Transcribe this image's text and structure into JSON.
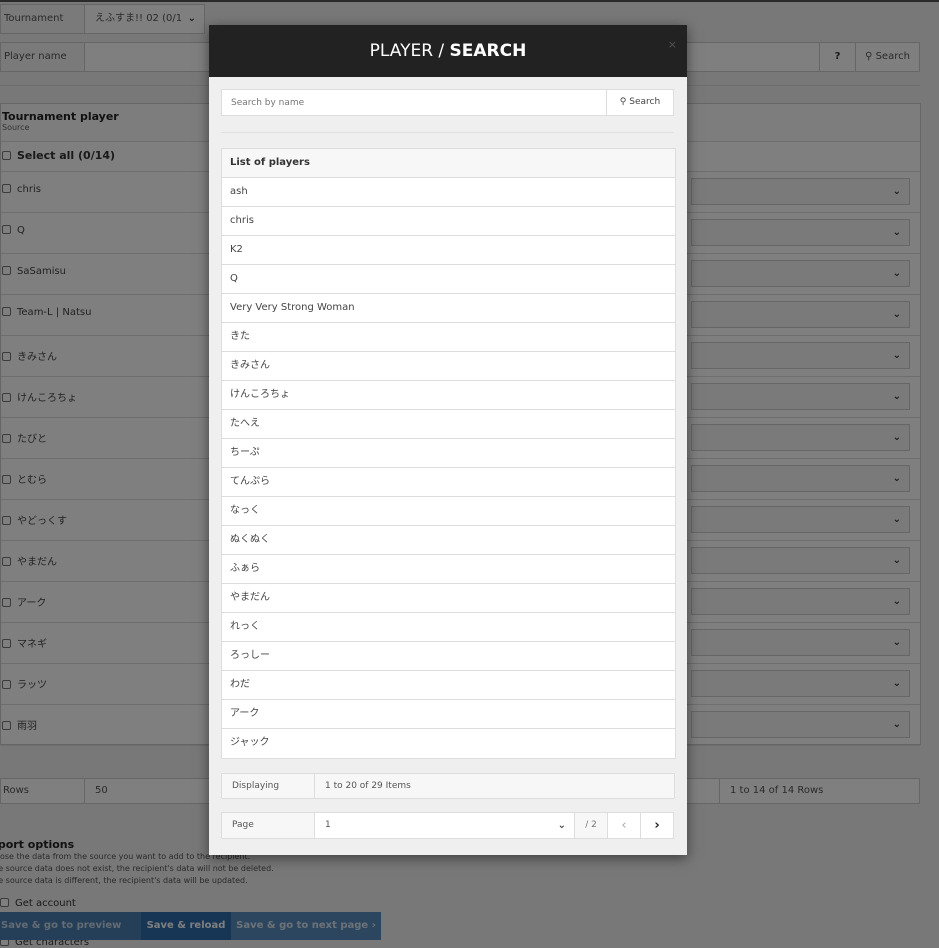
{
  "background": {
    "tournament": {
      "label": "Tournament",
      "value": "えふすま!! 02 (0/1"
    },
    "player_name": {
      "label": "Player name",
      "value": "",
      "help_icon": "question-circle-icon",
      "search_label": "Search",
      "search_icon": "search-icon"
    },
    "panel": {
      "title": "Tournament player",
      "subtitle": "Source",
      "select_all": "Select all (0/14)",
      "players": [
        "chris",
        "Q",
        "SaSamisu",
        "Team-L | Natsu",
        "きみさん",
        "けんころちょ",
        "たびと",
        "とむら",
        "やどっくす",
        "やまだん",
        "アーク",
        "マネギ",
        "ラッツ",
        "雨羽"
      ]
    },
    "rows": {
      "label": "Rows",
      "value": "50",
      "info": "1 to 14 of 14 Rows"
    },
    "import_options": {
      "title": "nport options",
      "lines": [
        "hoose the data from the source you want to add to the recipient.",
        "the source data does not exist, the recipient's data will not be deleted.",
        "the source data is different, the recipient's data will be updated."
      ],
      "options": [
        "Get account",
        "Get characters"
      ]
    },
    "actions": {
      "prev": "Save & go to preview page",
      "reload": "Save & reload",
      "next": "Save & go to next page",
      "next_icon": "›"
    }
  },
  "modal": {
    "title_part1": "PLAYER / ",
    "title_part2": "SEARCH",
    "close_icon": "×",
    "search": {
      "placeholder": "Search by name",
      "value": "",
      "button_label": "Search"
    },
    "list_header": "List of players",
    "players": [
      "ash",
      "chris",
      "K2",
      "Q",
      "Very Very Strong Woman",
      "きた",
      "きみさん",
      "けんころちょ",
      "たへえ",
      "ちーぷ",
      "てんぷら",
      "なっく",
      "ぬくぬく",
      "ふぁら",
      "やまだん",
      "れっく",
      "ろっしー",
      "わだ",
      "アーク",
      "ジャック"
    ],
    "displaying": {
      "label": "Displaying",
      "value": "1 to 20 of 29 Items"
    },
    "page": {
      "label": "Page",
      "value": "1",
      "total": "/ 2",
      "prev_icon": "‹",
      "next_icon": "›"
    }
  }
}
